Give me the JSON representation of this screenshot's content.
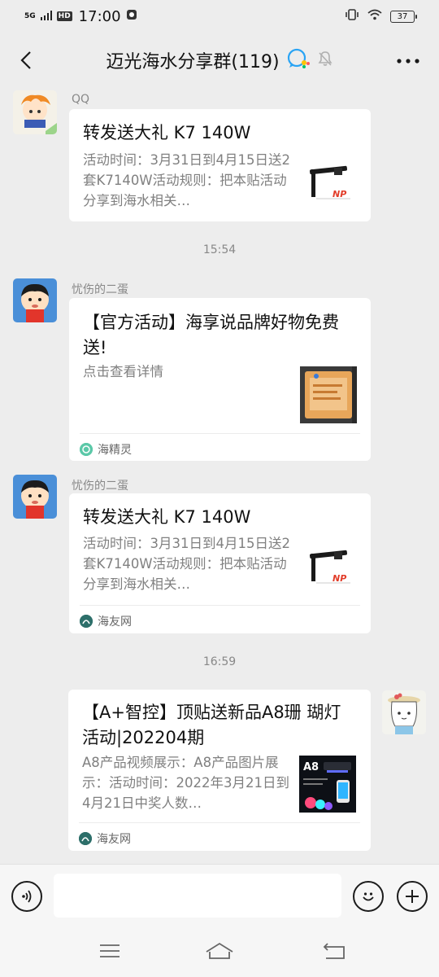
{
  "status_bar": {
    "network": "5G",
    "hd": "HD",
    "time": "17:00",
    "battery": "37"
  },
  "header": {
    "title": "迈光海水分享群(119)"
  },
  "messages": [
    {
      "sender": "QQ",
      "title": "转发送大礼 K7 140W",
      "desc": "活动时间：3月31日到4月15日送2套K7140W活动规则：把本贴活动分享到海水相关…",
      "source": ""
    },
    {
      "sender": "忧伤的二蛋",
      "title": "【官方活动】海享说品牌好物免费送!",
      "desc": "点击查看详情",
      "source": "海精灵"
    },
    {
      "sender": "忧伤的二蛋",
      "title": "转发送大礼 K7 140W",
      "desc": "活动时间：3月31日到4月15日送2套K7140W活动规则：把本贴活动分享到海水相关…",
      "source": "海友网"
    },
    {
      "sender": "",
      "title": "【A+智控】顶贴送新品A8珊 瑚灯活动|202204期",
      "desc": "A8产品视频展示：A8产品图片展示：活动时间：2022年3月21日到4月21日中奖人数…",
      "source": "海友网"
    }
  ],
  "timestamps": [
    "15:54",
    "16:59"
  ],
  "thumb_labels": {
    "np": "NP",
    "a8": "A8"
  },
  "input": {
    "value": ""
  },
  "colors": {
    "background": "#ededed",
    "card": "#ffffff",
    "muted_text": "#808080",
    "haijingling_icon": "#5bc8a8",
    "haiyouwang_icon": "#2d6f6a"
  },
  "icons": [
    "back-icon",
    "group-chat-icon",
    "mute-bell-icon",
    "more-icon",
    "voice-icon",
    "emoji-icon",
    "plus-icon",
    "menu-icon",
    "home-icon",
    "return-icon"
  ]
}
